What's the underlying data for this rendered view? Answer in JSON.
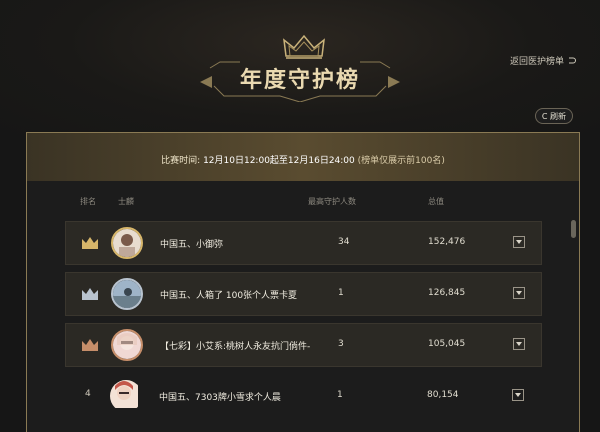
{
  "header": {
    "title": "年度守护榜",
    "rule_label": "返回医护榜单",
    "refresh_label": "C 刷新"
  },
  "period": {
    "label": "比赛时间:",
    "range": "12月10日12:00起至12月16日24:00",
    "note": "(榜单仅展示前100名)"
  },
  "columns": {
    "rank": "排名",
    "idol": "士麟",
    "guards": "最高守护人数",
    "score": "总值"
  },
  "rows": [
    {
      "rank": "1",
      "name": "中国五、小御弥",
      "guards": "34",
      "score": "152,476",
      "badge": "gold"
    },
    {
      "rank": "2",
      "name": "中国五、人箱了 100张个人票卡夏",
      "guards": "1",
      "score": "126,845",
      "badge": "silver"
    },
    {
      "rank": "3",
      "name": "【七彩】小艾系:桃树人永友抗门倘件-",
      "guards": "3",
      "score": "105,045",
      "badge": "bronze"
    },
    {
      "rank": "4",
      "name": "中国五、7303牌小雪求个人晨",
      "guards": "1",
      "score": "80,154",
      "badge": "none"
    }
  ],
  "colors": {
    "accent_gold": "#d7b66a",
    "panel_border": "#8a7a54",
    "background": "#161616"
  }
}
